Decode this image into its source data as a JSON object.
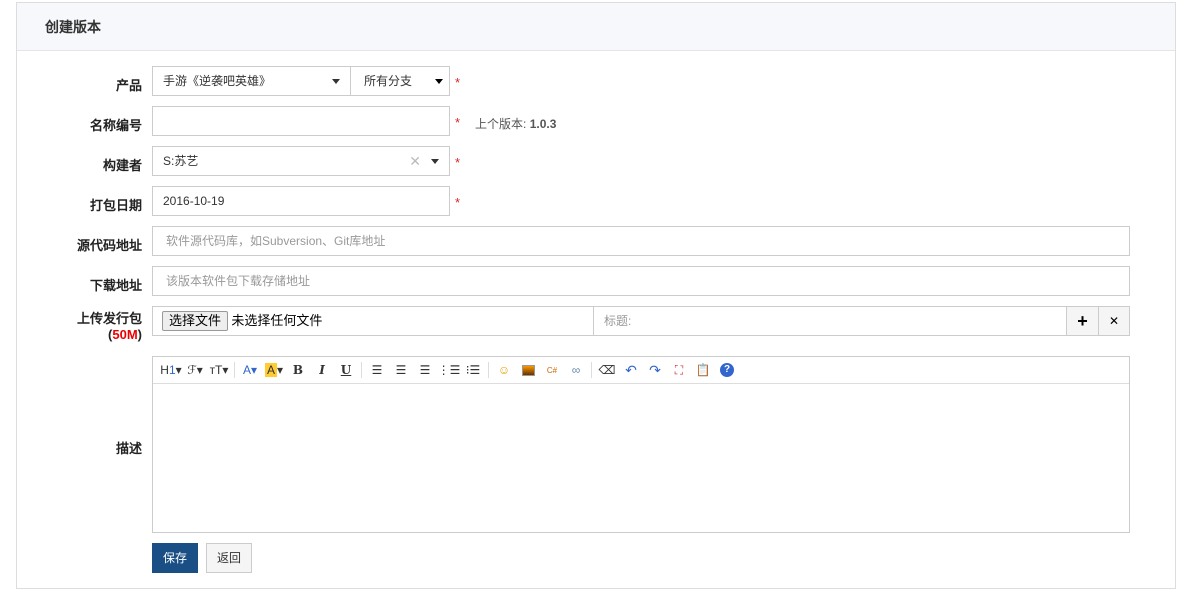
{
  "header": {
    "title": "创建版本"
  },
  "form": {
    "product": {
      "label": "产品",
      "value": "手游《逆袭吧英雄》",
      "branch": "所有分支"
    },
    "name": {
      "label": "名称编号",
      "value": "",
      "last_version_label": "上个版本:",
      "last_version": "1.0.3"
    },
    "builder": {
      "label": "构建者",
      "value": "S:苏艺"
    },
    "date": {
      "label": "打包日期",
      "value": "2016-10-19"
    },
    "source": {
      "label": "源代码地址",
      "placeholder": "软件源代码库，如Subversion、Git库地址"
    },
    "download": {
      "label": "下载地址",
      "placeholder": "该版本软件包下载存储地址"
    },
    "upload": {
      "label": "上传发行包",
      "size_open": "(",
      "size": "50M",
      "size_close": ")",
      "choose": "选择文件",
      "no_file": "未选择任何文件",
      "title_placeholder": "标题:",
      "add": "+",
      "remove": "✕"
    },
    "desc": {
      "label": "描述"
    },
    "required": "*"
  },
  "actions": {
    "save": "保存",
    "back": "返回"
  },
  "colors": {
    "primary": "#1a4f85",
    "required": "#d22",
    "size": "#e00"
  }
}
